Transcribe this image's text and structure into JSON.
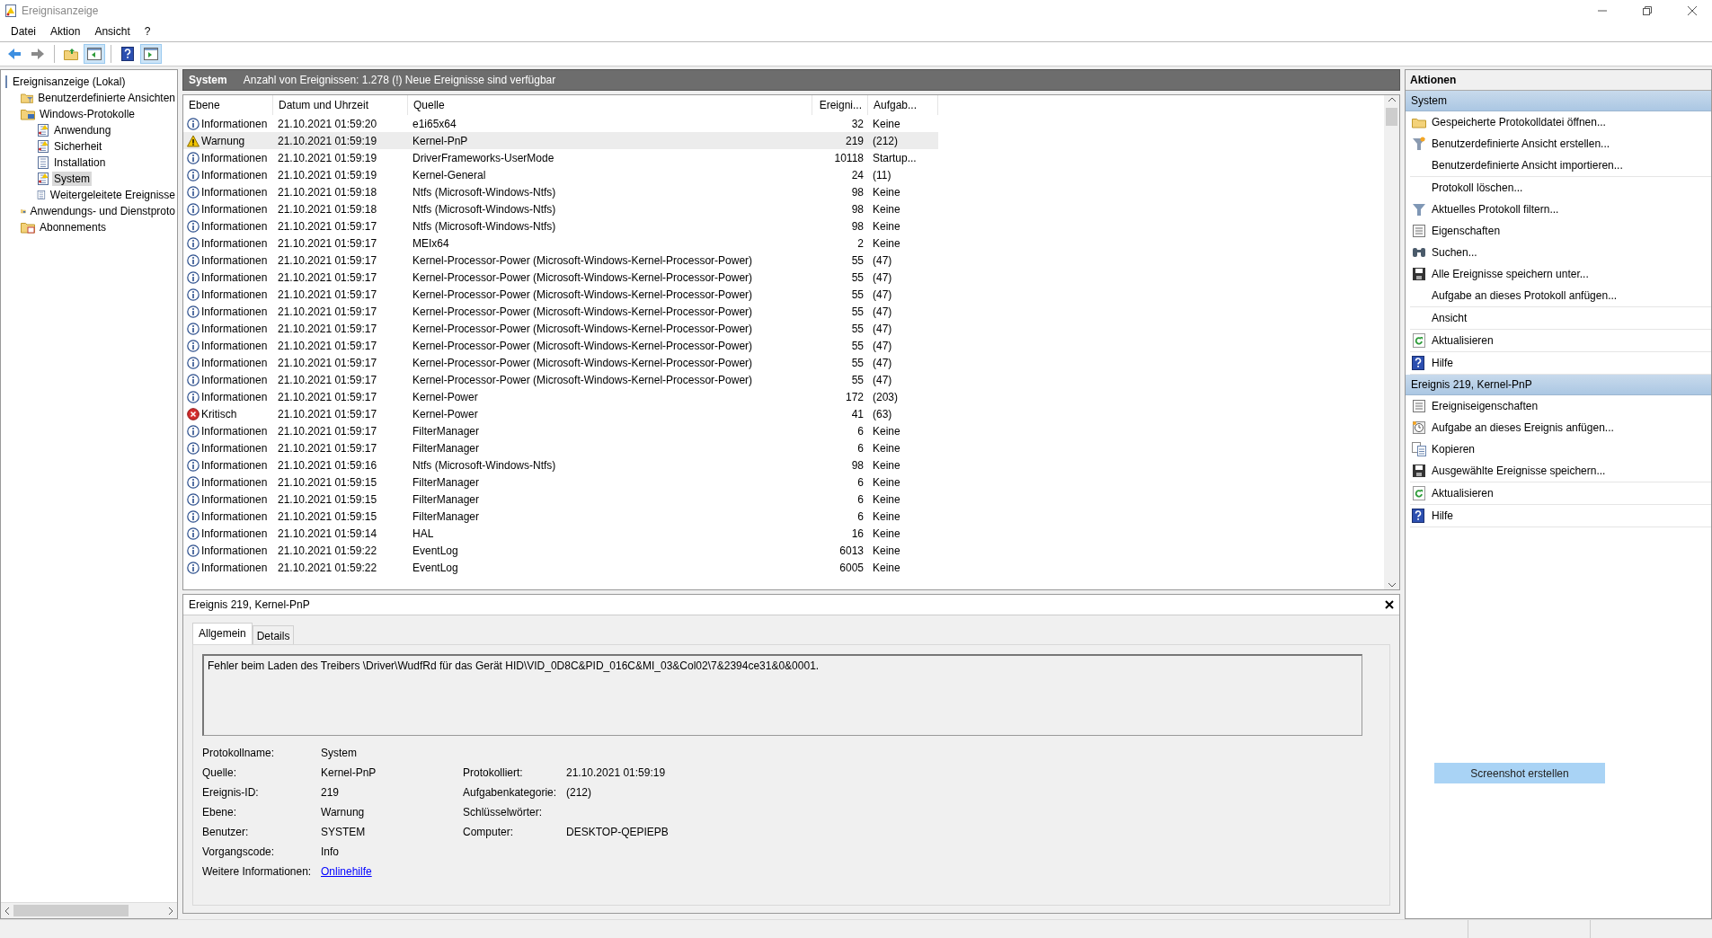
{
  "window": {
    "title": "Ereignisanzeige"
  },
  "menu": [
    "Datei",
    "Aktion",
    "Ansicht",
    "?"
  ],
  "toolbar": [
    [
      {
        "pressed": false
      },
      {
        "pressed": false
      }
    ],
    [
      {
        "pressed": false
      },
      {
        "pressed": true
      }
    ],
    [
      {
        "pressed": false
      },
      {
        "pressed": true
      }
    ]
  ],
  "tree": [
    {
      "label": "Ereignisanzeige (Lokal)",
      "kind": "root",
      "selected": false,
      "children": [
        {
          "label": "Benutzerdefinierte Ansichten",
          "kind": "filter-folder",
          "selected": false
        },
        {
          "label": "Windows-Protokolle",
          "kind": "folder",
          "selected": false,
          "children": [
            {
              "label": "Anwendung",
              "kind": "log",
              "selected": false
            },
            {
              "label": "Sicherheit",
              "kind": "log",
              "selected": false
            },
            {
              "label": "Installation",
              "kind": "plain-log",
              "selected": false
            },
            {
              "label": "System",
              "kind": "log",
              "selected": true
            },
            {
              "label": "Weitergeleitete Ereignisse",
              "kind": "plain-log",
              "selected": false
            }
          ]
        },
        {
          "label": "Anwendungs- und Dienstproto",
          "kind": "folder",
          "selected": false
        },
        {
          "label": "Abonnements",
          "kind": "subscription",
          "selected": false
        }
      ]
    }
  ],
  "log_header": {
    "title": "System",
    "summary": "Anzahl von Ereignissen: 1.278 (!) Neue Ereignisse sind verfügbar"
  },
  "table": {
    "columns": [
      "Ebene",
      "Datum und Uhrzeit",
      "Quelle",
      "Ereigni...",
      "Aufgab..."
    ],
    "rows": [
      {
        "kind": "info",
        "ebene": "Informationen",
        "date": "21.10.2021 01:59:20",
        "source": "e1i65x64",
        "id": "32",
        "task": "Keine",
        "selected": false
      },
      {
        "kind": "warning",
        "ebene": "Warnung",
        "date": "21.10.2021 01:59:19",
        "source": "Kernel-PnP",
        "id": "219",
        "task": "(212)",
        "selected": true
      },
      {
        "kind": "info",
        "ebene": "Informationen",
        "date": "21.10.2021 01:59:19",
        "source": "DriverFrameworks-UserMode",
        "id": "10118",
        "task": "Startup...",
        "selected": false
      },
      {
        "kind": "info",
        "ebene": "Informationen",
        "date": "21.10.2021 01:59:19",
        "source": "Kernel-General",
        "id": "24",
        "task": "(11)",
        "selected": false
      },
      {
        "kind": "info",
        "ebene": "Informationen",
        "date": "21.10.2021 01:59:18",
        "source": "Ntfs (Microsoft-Windows-Ntfs)",
        "id": "98",
        "task": "Keine",
        "selected": false
      },
      {
        "kind": "info",
        "ebene": "Informationen",
        "date": "21.10.2021 01:59:18",
        "source": "Ntfs (Microsoft-Windows-Ntfs)",
        "id": "98",
        "task": "Keine",
        "selected": false
      },
      {
        "kind": "info",
        "ebene": "Informationen",
        "date": "21.10.2021 01:59:17",
        "source": "Ntfs (Microsoft-Windows-Ntfs)",
        "id": "98",
        "task": "Keine",
        "selected": false
      },
      {
        "kind": "info",
        "ebene": "Informationen",
        "date": "21.10.2021 01:59:17",
        "source": "MEIx64",
        "id": "2",
        "task": "Keine",
        "selected": false
      },
      {
        "kind": "info",
        "ebene": "Informationen",
        "date": "21.10.2021 01:59:17",
        "source": "Kernel-Processor-Power (Microsoft-Windows-Kernel-Processor-Power)",
        "id": "55",
        "task": "(47)",
        "selected": false
      },
      {
        "kind": "info",
        "ebene": "Informationen",
        "date": "21.10.2021 01:59:17",
        "source": "Kernel-Processor-Power (Microsoft-Windows-Kernel-Processor-Power)",
        "id": "55",
        "task": "(47)",
        "selected": false
      },
      {
        "kind": "info",
        "ebene": "Informationen",
        "date": "21.10.2021 01:59:17",
        "source": "Kernel-Processor-Power (Microsoft-Windows-Kernel-Processor-Power)",
        "id": "55",
        "task": "(47)",
        "selected": false
      },
      {
        "kind": "info",
        "ebene": "Informationen",
        "date": "21.10.2021 01:59:17",
        "source": "Kernel-Processor-Power (Microsoft-Windows-Kernel-Processor-Power)",
        "id": "55",
        "task": "(47)",
        "selected": false
      },
      {
        "kind": "info",
        "ebene": "Informationen",
        "date": "21.10.2021 01:59:17",
        "source": "Kernel-Processor-Power (Microsoft-Windows-Kernel-Processor-Power)",
        "id": "55",
        "task": "(47)",
        "selected": false
      },
      {
        "kind": "info",
        "ebene": "Informationen",
        "date": "21.10.2021 01:59:17",
        "source": "Kernel-Processor-Power (Microsoft-Windows-Kernel-Processor-Power)",
        "id": "55",
        "task": "(47)",
        "selected": false
      },
      {
        "kind": "info",
        "ebene": "Informationen",
        "date": "21.10.2021 01:59:17",
        "source": "Kernel-Processor-Power (Microsoft-Windows-Kernel-Processor-Power)",
        "id": "55",
        "task": "(47)",
        "selected": false
      },
      {
        "kind": "info",
        "ebene": "Informationen",
        "date": "21.10.2021 01:59:17",
        "source": "Kernel-Processor-Power (Microsoft-Windows-Kernel-Processor-Power)",
        "id": "55",
        "task": "(47)",
        "selected": false
      },
      {
        "kind": "info",
        "ebene": "Informationen",
        "date": "21.10.2021 01:59:17",
        "source": "Kernel-Power",
        "id": "172",
        "task": "(203)",
        "selected": false
      },
      {
        "kind": "critical",
        "ebene": "Kritisch",
        "date": "21.10.2021 01:59:17",
        "source": "Kernel-Power",
        "id": "41",
        "task": "(63)",
        "selected": false
      },
      {
        "kind": "info",
        "ebene": "Informationen",
        "date": "21.10.2021 01:59:17",
        "source": "FilterManager",
        "id": "6",
        "task": "Keine",
        "selected": false
      },
      {
        "kind": "info",
        "ebene": "Informationen",
        "date": "21.10.2021 01:59:17",
        "source": "FilterManager",
        "id": "6",
        "task": "Keine",
        "selected": false
      },
      {
        "kind": "info",
        "ebene": "Informationen",
        "date": "21.10.2021 01:59:16",
        "source": "Ntfs (Microsoft-Windows-Ntfs)",
        "id": "98",
        "task": "Keine",
        "selected": false
      },
      {
        "kind": "info",
        "ebene": "Informationen",
        "date": "21.10.2021 01:59:15",
        "source": "FilterManager",
        "id": "6",
        "task": "Keine",
        "selected": false
      },
      {
        "kind": "info",
        "ebene": "Informationen",
        "date": "21.10.2021 01:59:15",
        "source": "FilterManager",
        "id": "6",
        "task": "Keine",
        "selected": false
      },
      {
        "kind": "info",
        "ebene": "Informationen",
        "date": "21.10.2021 01:59:15",
        "source": "FilterManager",
        "id": "6",
        "task": "Keine",
        "selected": false
      },
      {
        "kind": "info",
        "ebene": "Informationen",
        "date": "21.10.2021 01:59:14",
        "source": "HAL",
        "id": "16",
        "task": "Keine",
        "selected": false
      },
      {
        "kind": "info",
        "ebene": "Informationen",
        "date": "21.10.2021 01:59:22",
        "source": "EventLog",
        "id": "6013",
        "task": "Keine",
        "selected": false
      },
      {
        "kind": "info",
        "ebene": "Informationen",
        "date": "21.10.2021 01:59:22",
        "source": "EventLog",
        "id": "6005",
        "task": "Keine",
        "selected": false
      }
    ]
  },
  "details": {
    "title": "Ereignis 219, Kernel-PnP",
    "tabs": [
      {
        "label": "Allgemein",
        "selected": true
      },
      {
        "label": "Details",
        "selected": false
      }
    ],
    "message": "Fehler beim Laden des Treibers \\Driver\\WudfRd für das Gerät HID\\VID_0D8C&PID_016C&MI_03&Col02\\7&2394ce31&0&0001.",
    "rows": [
      [
        {
          "label": "Protokollname:",
          "value": "System"
        }
      ],
      [
        {
          "label": "Quelle:",
          "value": "Kernel-PnP"
        },
        {
          "label": "Protokolliert:",
          "value": "21.10.2021 01:59:19"
        }
      ],
      [
        {
          "label": "Ereignis-ID:",
          "value": "219"
        },
        {
          "label": "Aufgabenkategorie:",
          "value": "(212)"
        }
      ],
      [
        {
          "label": "Ebene:",
          "value": "Warnung"
        },
        {
          "label": "Schlüsselwörter:"
        }
      ],
      [
        {
          "label": "Benutzer:",
          "value": "SYSTEM"
        },
        {
          "label": "Computer:",
          "value": "DESKTOP-QEPIEPB"
        }
      ],
      [
        {
          "label": "Vorgangscode:",
          "value": "Info"
        }
      ],
      [
        {
          "label": "Weitere Informationen:",
          "value": "Onlinehilfe",
          "kind": "link"
        }
      ]
    ]
  },
  "actions": {
    "title": "Aktionen",
    "sections": [
      {
        "title": "System",
        "groups": [
          [
            {
              "label": "Gespeicherte Protokolldatei öffnen..."
            },
            {
              "label": "Benutzerdefinierte Ansicht erstellen..."
            },
            {
              "label": "Benutzerdefinierte Ansicht importieren..."
            }
          ],
          [
            {
              "label": "Protokoll löschen..."
            },
            {
              "label": "Aktuelles Protokoll filtern..."
            },
            {
              "label": "Eigenschaften"
            },
            {
              "label": "Suchen..."
            },
            {
              "label": "Alle Ereignisse speichern unter..."
            },
            {
              "label": "Aufgabe an dieses Protokoll anfügen..."
            }
          ],
          [
            {
              "label": "Ansicht"
            }
          ],
          [
            {
              "label": "Aktualisieren"
            }
          ],
          [
            {
              "label": "Hilfe"
            }
          ]
        ]
      },
      {
        "title": "Ereignis 219, Kernel-PnP",
        "groups": [
          [
            {
              "label": "Ereigniseigenschaften"
            },
            {
              "label": "Aufgabe an dieses Ereignis anfügen..."
            },
            {
              "label": "Kopieren"
            },
            {
              "label": "Ausgewählte Ereignisse speichern..."
            }
          ],
          [
            {
              "label": "Aktualisieren"
            }
          ],
          [
            {
              "label": "Hilfe"
            }
          ]
        ]
      }
    ],
    "screenshot_button": "Screenshot erstellen"
  }
}
